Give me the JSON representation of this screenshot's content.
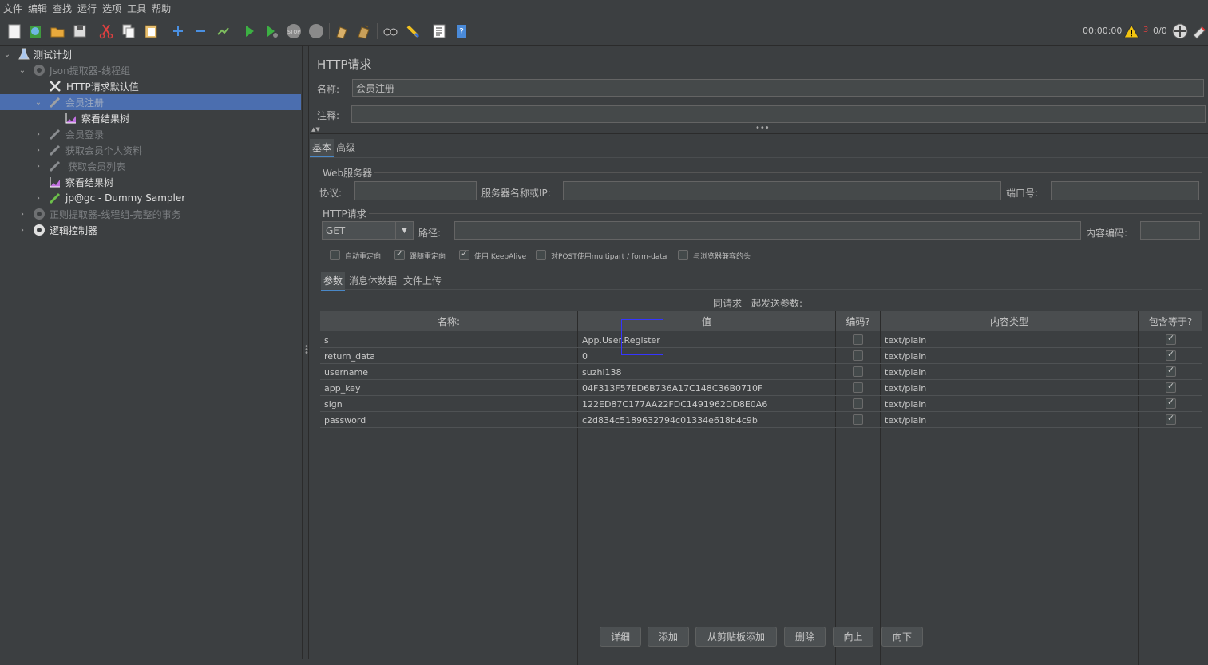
{
  "menu": [
    "文件",
    "编辑",
    "查找",
    "运行",
    "选项",
    "工具",
    "帮助"
  ],
  "toolbar": {
    "timer": "00:00:00",
    "warn_count": "3",
    "threads": "0/0",
    "icons": [
      "new-icon",
      "templates-icon",
      "open-icon",
      "save-icon",
      "cut-icon",
      "copy-icon",
      "paste-icon",
      "expand-icon",
      "collapse-icon",
      "toggle-icon",
      "start-icon",
      "start-no-pause-icon",
      "stop-icon",
      "shutdown-icon",
      "clear-icon",
      "clear-all-icon",
      "search-icon",
      "reset-search-icon",
      "function-helper-icon",
      "help-icon"
    ]
  },
  "tree": {
    "items": [
      {
        "label": "测试计划",
        "icon": "flask-icon",
        "state": "normal"
      },
      {
        "label": "Json提取器-线程组",
        "icon": "gear-icon",
        "state": "disabled"
      },
      {
        "label": "HTTP请求默认值",
        "icon": "wrench-icon",
        "state": "normal"
      },
      {
        "label": "会员注册",
        "icon": "pipette-icon",
        "state": "selected"
      },
      {
        "label": "察看结果树",
        "icon": "graph-icon",
        "state": "normal"
      },
      {
        "label": "会员登录",
        "icon": "pipette-icon",
        "state": "disabled"
      },
      {
        "label": "获取会员个人资料",
        "icon": "pipette-icon",
        "state": "disabled"
      },
      {
        "label": "获取会员列表",
        "icon": "pipette-icon",
        "state": "disabled"
      },
      {
        "label": "察看结果树",
        "icon": "graph-icon",
        "state": "normal"
      },
      {
        "label": "jp@gc - Dummy Sampler",
        "icon": "pipette-icon",
        "state": "normal"
      },
      {
        "label": "正则提取器-线程组-完整的事务",
        "icon": "gear-icon",
        "state": "disabled"
      },
      {
        "label": "逻辑控制器",
        "icon": "gear-icon",
        "state": "normal"
      }
    ]
  },
  "panel": {
    "title": "HTTP请求",
    "name_label": "名称:",
    "name_value": "会员注册",
    "comment_label": "注释:",
    "comment_value": "",
    "tabs": [
      "基本",
      "高级"
    ],
    "web_server": {
      "title": "Web服务器",
      "protocol_label": "协议:",
      "server_label": "服务器名称或IP:",
      "port_label": "端口号:"
    },
    "http_request": {
      "title": "HTTP请求",
      "method": "GET",
      "path_label": "路径:",
      "encoding_label": "内容编码:"
    },
    "options": [
      {
        "label": "自动重定向",
        "checked": false
      },
      {
        "label": "跟随重定向",
        "checked": true
      },
      {
        "label": "使用 KeepAlive",
        "checked": true
      },
      {
        "label": "对POST使用multipart / form-data",
        "checked": false
      },
      {
        "label": "与浏览器兼容的头",
        "checked": false
      }
    ],
    "sub_tabs": [
      "参数",
      "消息体数据",
      "文件上传"
    ],
    "params_caption": "同请求一起发送参数:",
    "columns": [
      "名称:",
      "值",
      "编码?",
      "内容类型",
      "包含等于?"
    ],
    "rows": [
      {
        "name": "s",
        "value": "App.User.Register",
        "encode": false,
        "type": "text/plain",
        "include_equals": true
      },
      {
        "name": "return_data",
        "value": "0",
        "encode": false,
        "type": "text/plain",
        "include_equals": true
      },
      {
        "name": "username",
        "value": "suzhi138",
        "encode": false,
        "type": "text/plain",
        "include_equals": true
      },
      {
        "name": "app_key",
        "value": "04F313F57ED6B736A17C148C36B0710F",
        "encode": false,
        "type": "text/plain",
        "include_equals": true
      },
      {
        "name": "sign",
        "value": "122ED87C177AA22FDC1491962DD8E0A6",
        "encode": false,
        "type": "text/plain",
        "include_equals": true
      },
      {
        "name": "password",
        "value": "c2d834c5189632794c01334e618b4c9b",
        "encode": false,
        "type": "text/plain",
        "include_equals": true
      }
    ],
    "buttons": [
      "详细",
      "添加",
      "从剪贴板添加",
      "删除",
      "向上",
      "向下"
    ]
  },
  "colors": {
    "background": "#3c3f41",
    "selection": "#4b6eaf",
    "highlight_box": "#3535ff"
  }
}
